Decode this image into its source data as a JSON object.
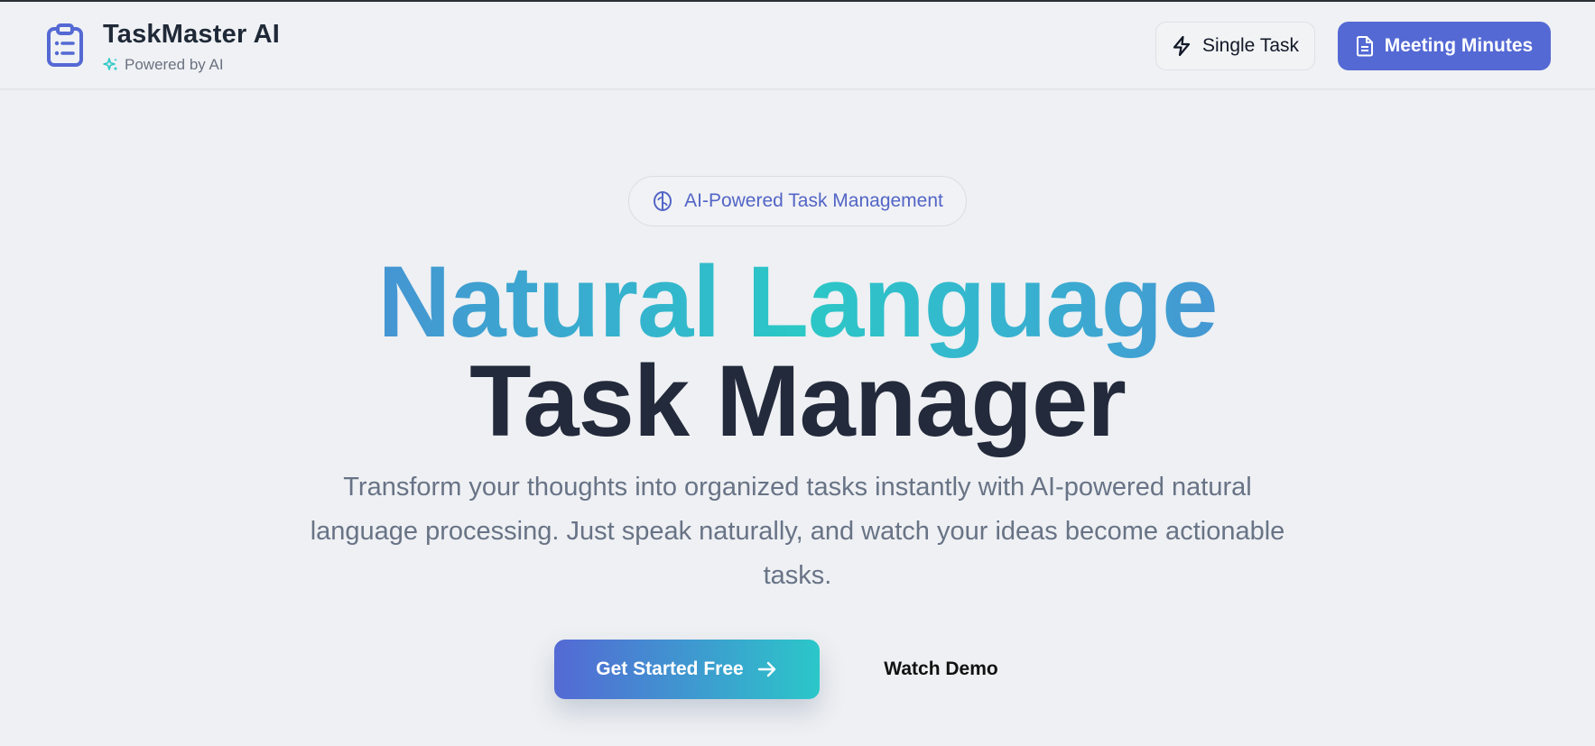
{
  "header": {
    "title": "TaskMaster AI",
    "subtitle": "Powered by AI",
    "logo_icon": "clipboard-list-icon",
    "sparkle_icon": "sparkles-icon",
    "single_task_label": "Single Task",
    "single_task_icon": "lightning-icon",
    "meeting_minutes_label": "Meeting Minutes",
    "meeting_minutes_icon": "document-icon"
  },
  "hero": {
    "badge_label": "AI-Powered Task Management",
    "badge_icon": "brain-icon",
    "headline_gradient": "Natural Language",
    "headline_dark": "Task Manager",
    "description": "Transform your thoughts into organized tasks instantly with AI-powered natural language processing. Just speak naturally, and watch your ideas become actionable tasks.",
    "cta_primary_label": "Get Started Free",
    "cta_primary_icon": "arrow-right-icon",
    "cta_secondary_label": "Watch Demo"
  },
  "colors": {
    "accent": "#5469d4",
    "gradient_start": "#4595d2",
    "gradient_mid": "#2bc8c6",
    "heading_dark": "#232a3b",
    "body_text": "#687386",
    "background": "#eef0f3"
  }
}
